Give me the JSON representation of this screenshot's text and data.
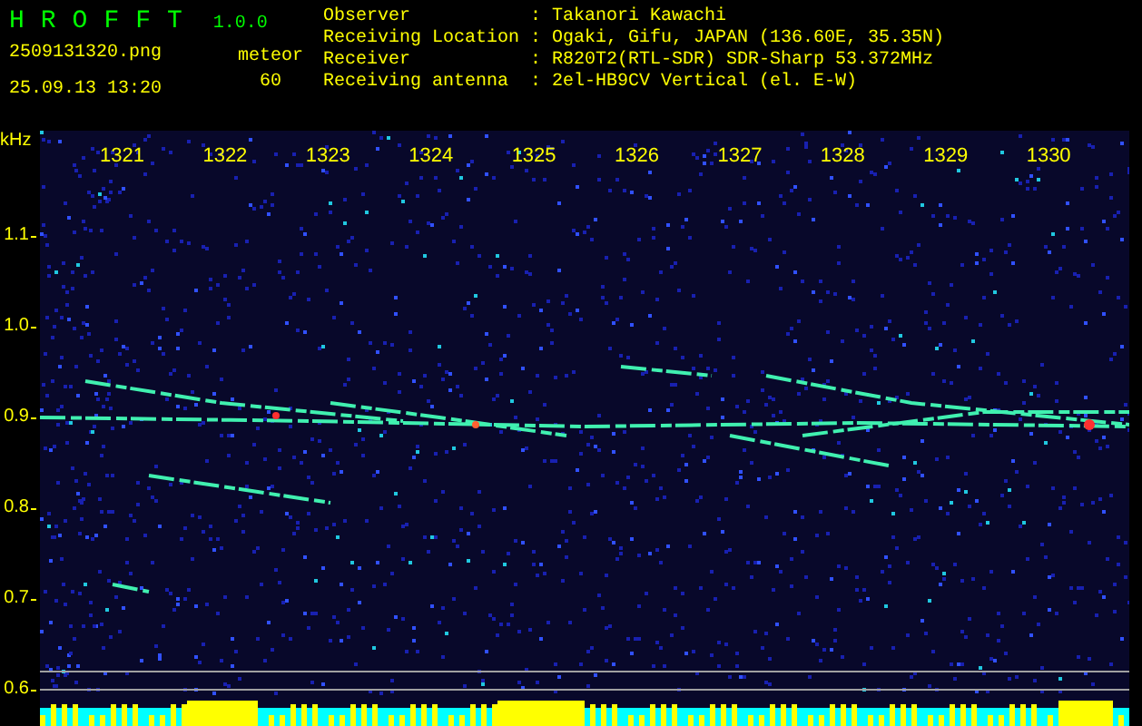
{
  "app": {
    "name": "HROFFT",
    "version": "1.0.0"
  },
  "file_name": "2509131320.png",
  "date_time": "25.09.13 13:20",
  "mode": "meteor",
  "count": "60",
  "info": [
    {
      "label": "Observer",
      "separator": ":",
      "value": "Takanori Kawachi"
    },
    {
      "label": "Receiving Location",
      "separator": ":",
      "value": "Ogaki, Gifu, JAPAN (136.60E, 35.35N)"
    },
    {
      "label": "Receiver",
      "separator": ":",
      "value": "R820T2(RTL-SDR) SDR-Sharp 53.372MHz"
    },
    {
      "label": "Receiving antenna",
      "separator": ":",
      "value": "2el-HB9CV Vertical (el. E-W)"
    }
  ],
  "frequency_axis": {
    "unit": "kHz",
    "labels": [
      "1.1",
      "1.0",
      "0.9",
      "0.8",
      "0.7",
      "0.6"
    ]
  },
  "time_labels": [
    "1321",
    "1322",
    "1323",
    "1324",
    "1325",
    "1326",
    "1327",
    "1328",
    "1329",
    "1330"
  ]
}
